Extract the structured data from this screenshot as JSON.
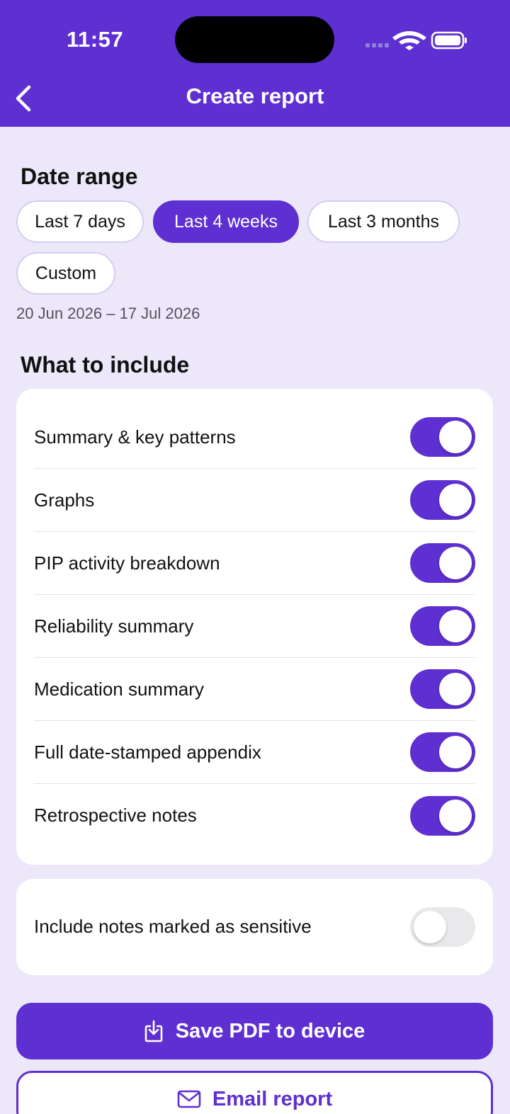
{
  "status_bar": {
    "time": "11:57"
  },
  "header": {
    "title": "Create report",
    "back_icon": "chevron-left-icon"
  },
  "date_range": {
    "title": "Date range",
    "options": [
      {
        "label": "Last 7 days",
        "selected": false
      },
      {
        "label": "Last 4 weeks",
        "selected": true
      },
      {
        "label": "Last 3 months",
        "selected": false
      },
      {
        "label": "Custom",
        "selected": false
      }
    ],
    "summary": "20 Jun 2026 – 17 Jul 2026"
  },
  "include": {
    "title": "What to include",
    "items": [
      {
        "label": "Summary & key patterns",
        "on": true
      },
      {
        "label": "Graphs",
        "on": true
      },
      {
        "label": "PIP activity breakdown",
        "on": true
      },
      {
        "label": "Reliability summary",
        "on": true
      },
      {
        "label": "Medication summary",
        "on": true
      },
      {
        "label": "Full date-stamped appendix",
        "on": true
      },
      {
        "label": "Retrospective notes",
        "on": true
      }
    ]
  },
  "sensitive": {
    "label": "Include notes marked as sensitive",
    "on": false
  },
  "actions": {
    "save_label": "Save PDF to device",
    "save_icon": "download-icon",
    "email_label": "Email report",
    "email_icon": "envelope-icon"
  },
  "colors": {
    "accent": "#5E2FD1",
    "background": "#ECE8FA",
    "card": "#FFFFFF"
  }
}
